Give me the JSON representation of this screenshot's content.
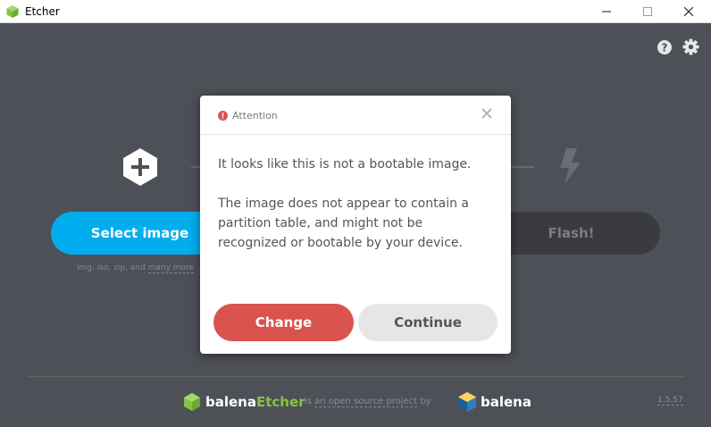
{
  "window": {
    "title": "Etcher",
    "controls": {
      "minimize": "minimize-icon",
      "maximize": "maximize-icon",
      "close": "close-icon"
    }
  },
  "toolbar": {
    "help_icon": "help-icon",
    "settings_icon": "gear-icon"
  },
  "steps": {
    "select_image_label": "Select image",
    "extensions_prefix": "img, iso, zip, and ",
    "extensions_more": "many more",
    "flash_label": "Flash!"
  },
  "dialog": {
    "title": "Attention",
    "message_1": "It looks like this is not a bootable image.",
    "message_2": "The image does not appear to contain a partition table, and might not be recognized or bootable by your device.",
    "change_label": "Change",
    "continue_label": "Continue"
  },
  "footer": {
    "brand_prefix": "balena",
    "brand_suffix": "Etcher",
    "mid_prefix": "is ",
    "mid_link": "an open source project",
    "mid_suffix": " by",
    "company": "balena",
    "version": "1.5.57"
  },
  "colors": {
    "background": "#4e5057",
    "accent": "#00aeef",
    "danger": "#d9534f",
    "etcher_green": "#85c341"
  }
}
